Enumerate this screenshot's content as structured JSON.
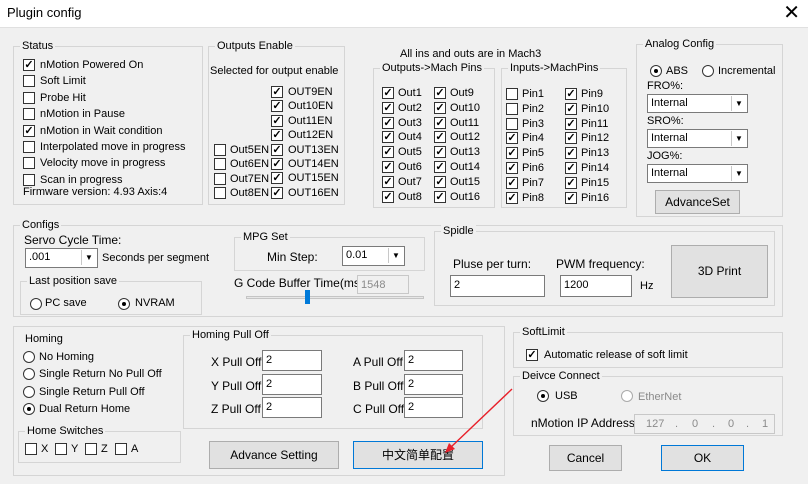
{
  "window": {
    "title": "Plugin config",
    "close_symbol": "✕"
  },
  "status": {
    "legend": "Status",
    "items": [
      {
        "label": "nMotion Powered On",
        "checked": true
      },
      {
        "label": "Soft Limit",
        "checked": false
      },
      {
        "label": "Probe Hit",
        "checked": false
      },
      {
        "label": "nMotion in Pause",
        "checked": false
      },
      {
        "label": "nMotion in Wait condition",
        "checked": true
      },
      {
        "label": "Interpolated move in progress",
        "checked": false
      },
      {
        "label": "Velocity move in progress",
        "checked": false
      },
      {
        "label": "Scan in progress",
        "checked": false
      }
    ],
    "firmware": "Firmware version: 4.93 Axis:4"
  },
  "outputs_enable": {
    "legend": "Outputs Enable",
    "subtitle": "Selected for output enable",
    "right_col": [
      {
        "label": "OUT9EN",
        "checked": true
      },
      {
        "label": "Out10EN",
        "checked": true
      },
      {
        "label": "Out11EN",
        "checked": true
      },
      {
        "label": "Out12EN",
        "checked": true
      },
      {
        "label": "OUT13EN",
        "checked": true
      },
      {
        "label": "OUT14EN",
        "checked": true
      },
      {
        "label": "OUT15EN",
        "checked": true
      },
      {
        "label": "OUT16EN",
        "checked": true
      }
    ],
    "left_col": [
      {
        "label": "Out5EN",
        "checked": false
      },
      {
        "label": "Out6EN",
        "checked": false
      },
      {
        "label": "Out7EN",
        "checked": false
      },
      {
        "label": "Out8EN",
        "checked": false
      }
    ]
  },
  "mach3_note": "All ins and outs are in Mach3",
  "outputs_mach": {
    "legend": "Outputs->Mach Pins",
    "col1": [
      "Out1",
      "Out2",
      "Out3",
      "Out4",
      "Out5",
      "Out6",
      "Out7",
      "Out8"
    ],
    "col2": [
      "Out9",
      "Out10",
      "Out11",
      "Out12",
      "Out13",
      "Out14",
      "Out15",
      "Out16"
    ]
  },
  "inputs_mach": {
    "legend": "Inputs->MachPins",
    "col1": [
      {
        "label": "Pin1",
        "checked": false
      },
      {
        "label": "Pin2",
        "checked": false
      },
      {
        "label": "Pin3",
        "checked": false
      },
      {
        "label": "Pin4",
        "checked": true
      },
      {
        "label": "Pin5",
        "checked": true
      },
      {
        "label": "Pin6",
        "checked": true
      },
      {
        "label": "Pin7",
        "checked": true
      },
      {
        "label": "Pin8",
        "checked": true
      }
    ],
    "col2": [
      {
        "label": "Pin9",
        "checked": true
      },
      {
        "label": "Pin10",
        "checked": true
      },
      {
        "label": "Pin11",
        "checked": true
      },
      {
        "label": "Pin12",
        "checked": true
      },
      {
        "label": "Pin13",
        "checked": true
      },
      {
        "label": "Pin14",
        "checked": true
      },
      {
        "label": "Pin15",
        "checked": true
      },
      {
        "label": "Pin16",
        "checked": true
      }
    ]
  },
  "analog": {
    "legend": "Analog Config",
    "abs": "ABS",
    "incremental": "Incremental",
    "fro_label": "FRO%:",
    "fro_value": "Internal",
    "sro_label": "SRO%:",
    "sro_value": "Internal",
    "jog_label": "JOG%:",
    "jog_value": "Internal",
    "advance_set": "AdvanceSet"
  },
  "configs": {
    "legend": "Configs",
    "servo_label": "Servo Cycle Time:",
    "servo_value": ".001",
    "servo_unit": "Seconds per segment",
    "lastpos_legend": "Last position save",
    "pc_save": "PC save",
    "nvram": "NVRAM",
    "mpg_legend": "MPG Set",
    "min_step_label": "Min Step:",
    "min_step_value": "0.01",
    "gcode_label": "G Code Buffer Time(ms):",
    "gcode_value": "1548",
    "spindle_legend": "Spidle",
    "pulse_label": "Pluse per turn:",
    "pulse_value": "2",
    "pwm_label": "PWM frequency:",
    "pwm_value": "1200",
    "hz": "Hz",
    "print_3d": "3D Print"
  },
  "homing": {
    "legend": "Homing",
    "options": [
      "No Homing",
      "Single Return No Pull Off",
      "Single Return Pull Off",
      "Dual Return Home"
    ],
    "selected": 3,
    "switches_legend": "Home Switches",
    "switches": [
      "X",
      "Y",
      "Z",
      "A"
    ],
    "pulloff_legend": "Homing Pull Off",
    "x_label": "X Pull Off",
    "x_value": "2",
    "y_label": "Y Pull Off",
    "y_value": "2",
    "z_label": "Z Pull Off",
    "z_value": "2",
    "a_label": "A Pull Off",
    "a_value": "2",
    "b_label": "B Pull Off",
    "b_value": "2",
    "c_label": "C Pull Off",
    "c_value": "2",
    "advance_setting": "Advance Setting",
    "chinese_config": "中文简单配置"
  },
  "softlimit": {
    "legend": "SoftLimit",
    "auto_release": "Automatic release of soft limit"
  },
  "device": {
    "legend": "Deivce Connect",
    "usb": "USB",
    "ethernet": "EtherNet",
    "ip_label": "nMotion IP Address:",
    "ip": [
      "127",
      "0",
      "0",
      "1"
    ]
  },
  "buttons": {
    "cancel": "Cancel",
    "ok": "OK"
  },
  "colors": {
    "arrow": "#e8202a",
    "focus_border": "#0078d7"
  }
}
